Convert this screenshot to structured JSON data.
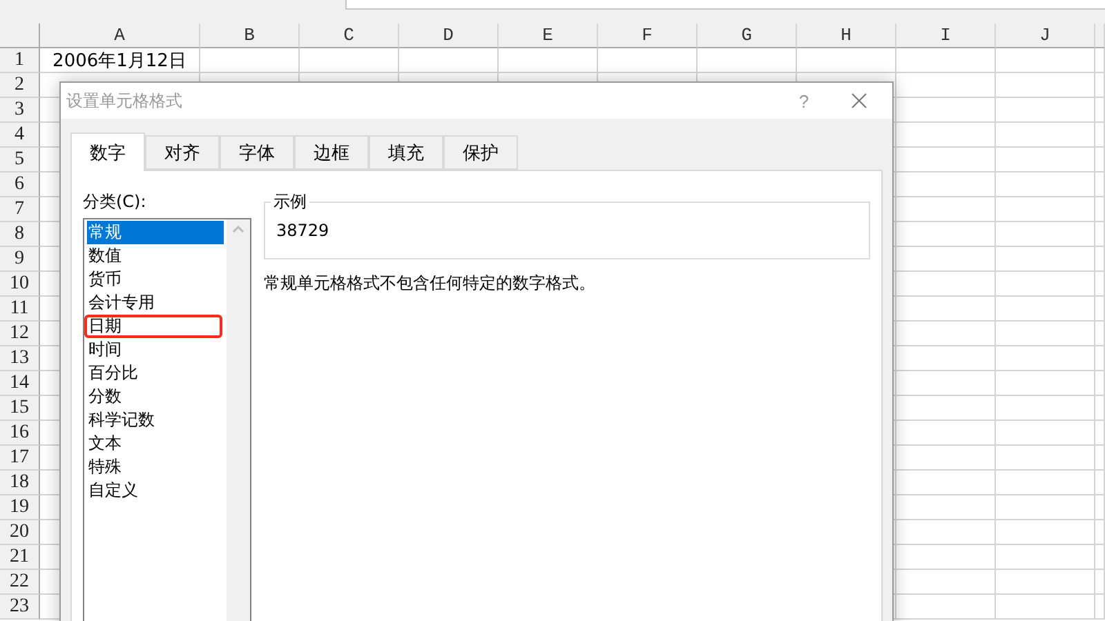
{
  "sheet": {
    "columns": [
      "A",
      "B",
      "C",
      "D",
      "E",
      "F",
      "G",
      "H",
      "I",
      "J"
    ],
    "rows": [
      {
        "label": "1",
        "cells": [
          "2006年1月12日"
        ]
      },
      {
        "label": "2"
      },
      {
        "label": "3"
      },
      {
        "label": "4"
      },
      {
        "label": "5"
      },
      {
        "label": "6"
      },
      {
        "label": "7"
      },
      {
        "label": "8"
      },
      {
        "label": "9"
      },
      {
        "label": "10"
      },
      {
        "label": "11"
      },
      {
        "label": "12"
      },
      {
        "label": "13"
      },
      {
        "label": "14"
      },
      {
        "label": "15"
      },
      {
        "label": "16"
      },
      {
        "label": "17"
      },
      {
        "label": "18"
      },
      {
        "label": "19"
      },
      {
        "label": "20"
      },
      {
        "label": "21"
      },
      {
        "label": "22"
      },
      {
        "label": "23"
      }
    ]
  },
  "dialog": {
    "title": "设置单元格格式",
    "help": "?",
    "tabs": [
      {
        "label": "数字",
        "selected": true
      },
      {
        "label": "对齐",
        "selected": false
      },
      {
        "label": "字体",
        "selected": false
      },
      {
        "label": "边框",
        "selected": false
      },
      {
        "label": "填充",
        "selected": false
      },
      {
        "label": "保护",
        "selected": false
      }
    ],
    "category_label": "分类(C):",
    "categories": [
      {
        "label": "常规",
        "selected": true,
        "annotated": false
      },
      {
        "label": "数值",
        "selected": false,
        "annotated": false
      },
      {
        "label": "货币",
        "selected": false,
        "annotated": false
      },
      {
        "label": "会计专用",
        "selected": false,
        "annotated": false
      },
      {
        "label": "日期",
        "selected": false,
        "annotated": true
      },
      {
        "label": "时间",
        "selected": false,
        "annotated": false
      },
      {
        "label": "百分比",
        "selected": false,
        "annotated": false
      },
      {
        "label": "分数",
        "selected": false,
        "annotated": false
      },
      {
        "label": "科学记数",
        "selected": false,
        "annotated": false
      },
      {
        "label": "文本",
        "selected": false,
        "annotated": false
      },
      {
        "label": "特殊",
        "selected": false,
        "annotated": false
      },
      {
        "label": "自定义",
        "selected": false,
        "annotated": false
      }
    ],
    "sample": {
      "label": "示例",
      "value": "38729"
    },
    "description": "常规单元格格式不包含任何特定的数字格式。"
  }
}
